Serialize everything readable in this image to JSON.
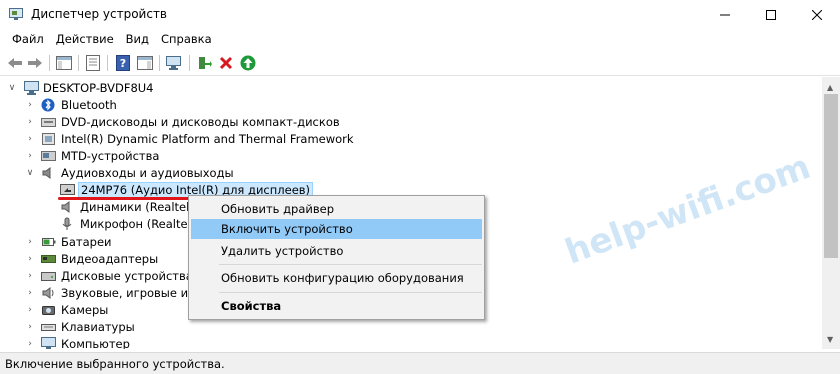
{
  "window": {
    "title": "Диспетчер устройств"
  },
  "menubar": [
    "Файл",
    "Действие",
    "Вид",
    "Справка"
  ],
  "toolbar": {
    "icons": [
      "back-icon",
      "forward-icon",
      "show-hide-tree-icon",
      "properties-icon",
      "help-icon",
      "action-pane-icon",
      "scan-hardware-icon",
      "update-driver-icon",
      "uninstall-icon",
      "enable-device-icon"
    ]
  },
  "tree": {
    "root": "DESKTOP-BVDF8U4",
    "items": [
      {
        "label": "Bluetooth",
        "icon": "bluetooth-icon",
        "expand": "collapsed"
      },
      {
        "label": "DVD-дисководы и дисководы компакт-дисков",
        "icon": "dvd-drive-icon",
        "expand": "collapsed"
      },
      {
        "label": "Intel(R) Dynamic Platform and Thermal Framework",
        "icon": "thermal-framework-icon",
        "expand": "collapsed"
      },
      {
        "label": "MTD-устройства",
        "icon": "mtd-device-icon",
        "expand": "collapsed"
      },
      {
        "label": "Аудиовходы и аудиовыходы",
        "icon": "audio-io-icon",
        "expand": "expanded"
      },
      {
        "label": "24MP76 (Аудио Intel(R) для дисплеев)",
        "icon": "display-audio-icon",
        "expand": "none",
        "selected": true
      },
      {
        "label": "Динамики (Realtek H",
        "icon": "speaker-icon",
        "expand": "none"
      },
      {
        "label": "Микрофон (Realtek H",
        "icon": "microphone-icon",
        "expand": "none"
      },
      {
        "label": "Батареи",
        "icon": "battery-icon",
        "expand": "collapsed"
      },
      {
        "label": "Видеоадаптеры",
        "icon": "video-adapter-icon",
        "expand": "collapsed"
      },
      {
        "label": "Дисковые устройства",
        "icon": "disk-drive-icon",
        "expand": "collapsed"
      },
      {
        "label": "Звуковые, игровые и ви",
        "icon": "sound-game-icon",
        "expand": "collapsed"
      },
      {
        "label": "Камеры",
        "icon": "camera-icon",
        "expand": "collapsed"
      },
      {
        "label": "Клавиатуры",
        "icon": "keyboard-icon",
        "expand": "collapsed"
      },
      {
        "label": "Компьютер",
        "icon": "computer-icon",
        "expand": "collapsed"
      }
    ]
  },
  "context_menu": {
    "items": [
      {
        "label": "Обновить драйвер",
        "highlighted": false,
        "bold": false
      },
      {
        "label": "Включить устройство",
        "highlighted": true,
        "bold": false
      },
      {
        "label": "Удалить устройство",
        "highlighted": false,
        "bold": false
      },
      {
        "label": "Обновить конфигурацию оборудования",
        "highlighted": false,
        "bold": false
      },
      {
        "label": "Свойства",
        "highlighted": false,
        "bold": true
      }
    ]
  },
  "statusbar": {
    "text": "Включение выбранного устройства."
  },
  "watermark": "help-wifi.com",
  "colors": {
    "selection_bg": "#cce8ff",
    "menu_highlight": "#91c9f7",
    "annotation_red": "#e2151a",
    "watermark": "#96c8eb"
  }
}
